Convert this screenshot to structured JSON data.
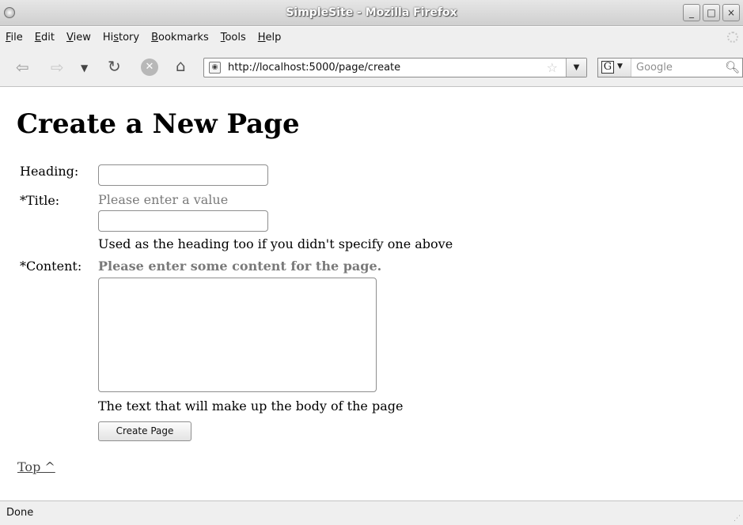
{
  "window": {
    "title": "SimpleSite - Mozilla Firefox",
    "controls": [
      "_",
      "□",
      "×"
    ]
  },
  "menu": [
    {
      "label": "File",
      "key": "F",
      "rest": "ile"
    },
    {
      "label": "Edit",
      "key": "E",
      "rest": "dit"
    },
    {
      "label": "View",
      "key": "V",
      "rest": "iew"
    },
    {
      "label": "History",
      "pre": "Hi",
      "key": "s",
      "rest": "tory"
    },
    {
      "label": "Bookmarks",
      "key": "B",
      "rest": "ookmarks"
    },
    {
      "label": "Tools",
      "key": "T",
      "rest": "ools"
    },
    {
      "label": "Help",
      "key": "H",
      "rest": "elp"
    }
  ],
  "toolbar": {
    "url": "http://localhost:5000/page/create",
    "search_placeholder": "Google",
    "engine_letter": "G"
  },
  "page": {
    "heading": "Create a New Page",
    "fields": {
      "heading_label": "Heading:",
      "title_label": "*Title:",
      "title_error": "Please enter a value",
      "title_help": "Used as the heading too if you didn't specify one above",
      "content_label": "*Content:",
      "content_error": "Please enter some content for the page.",
      "content_help": "The text that will make up the body of the page"
    },
    "submit_label": "Create Page",
    "top_link": "Top ^"
  },
  "status": {
    "text": "Done"
  }
}
